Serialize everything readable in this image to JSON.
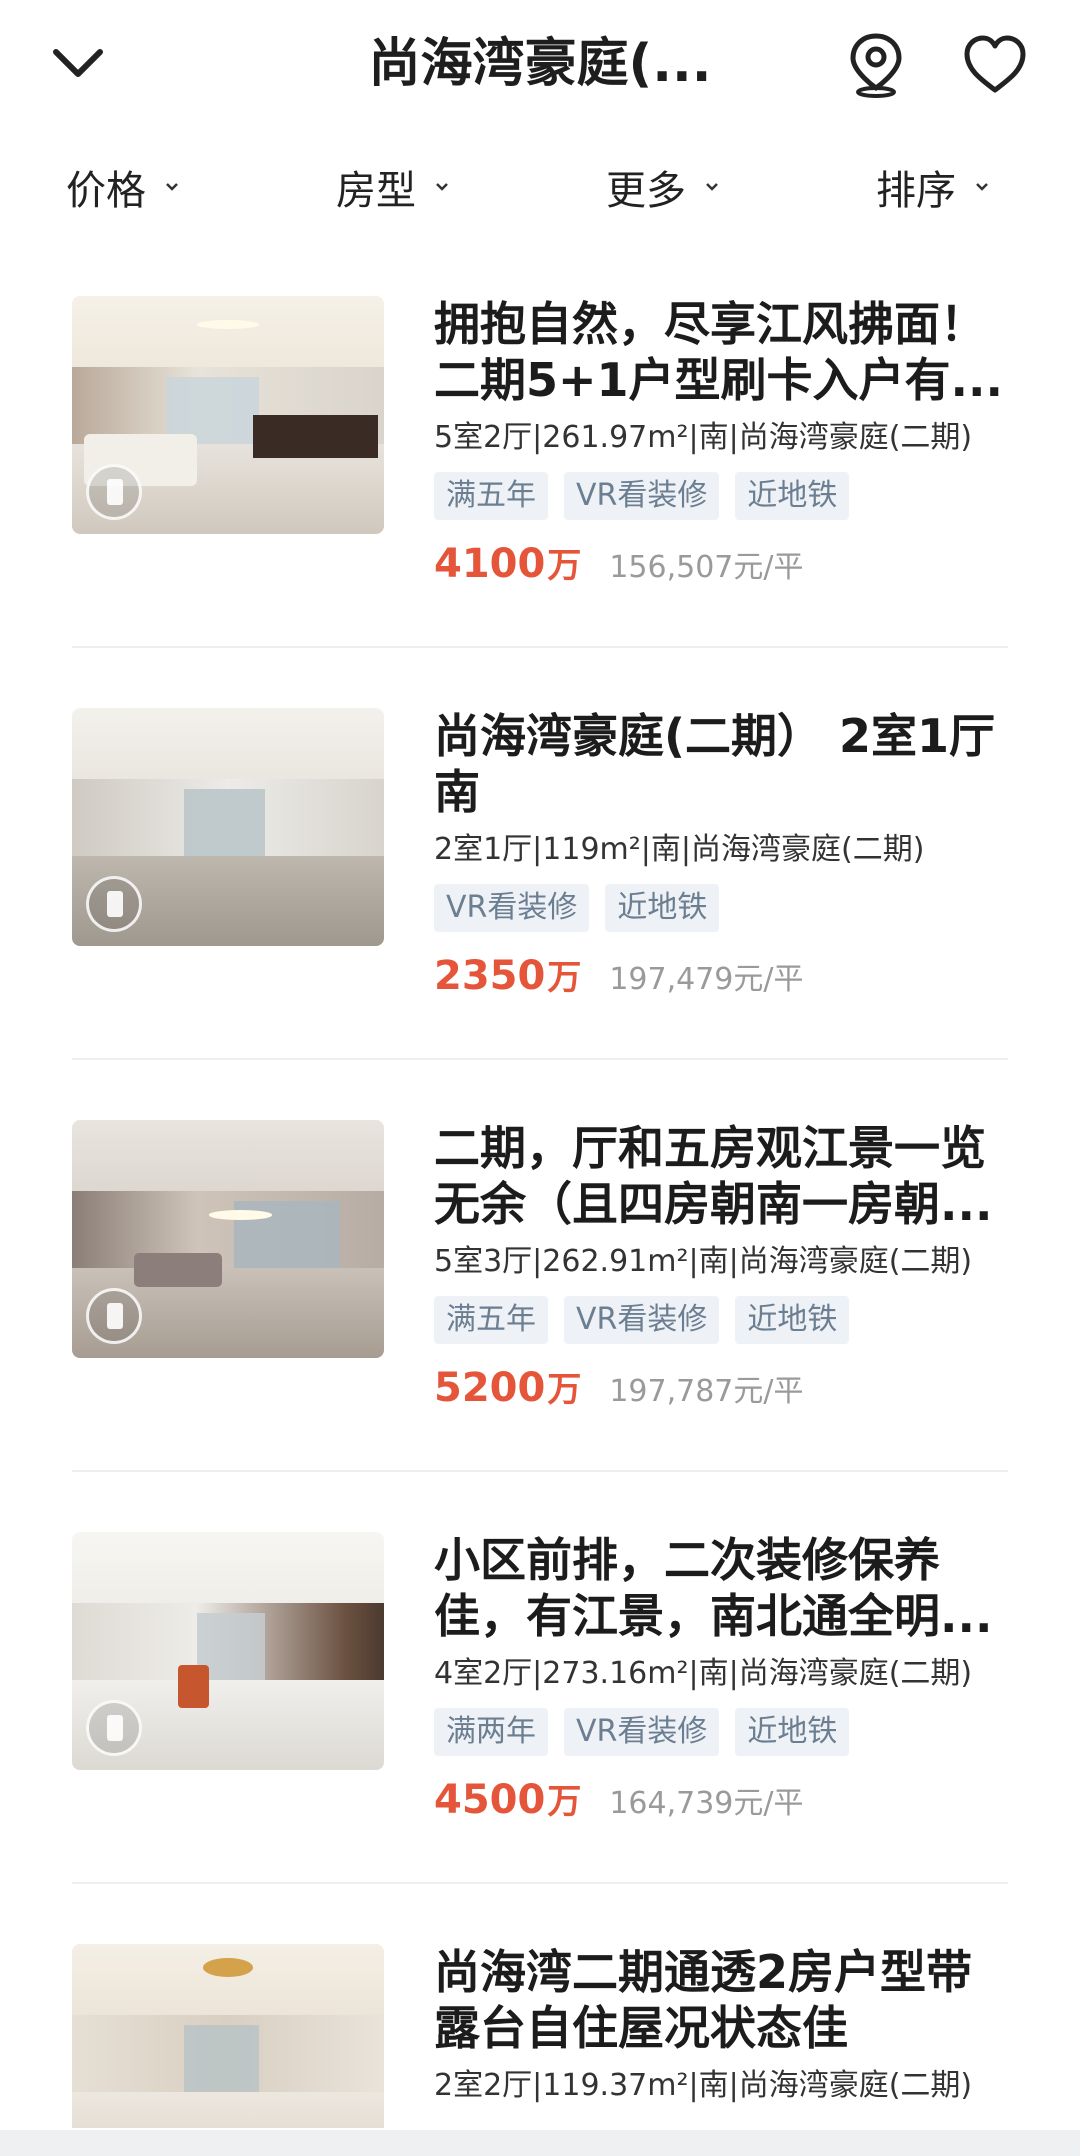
{
  "header": {
    "title": "尚海湾豪庭(...",
    "back_icon": "chevron-down-icon",
    "location_icon": "map-pin-icon",
    "favorite_icon": "heart-icon"
  },
  "filters": [
    {
      "label": "价格"
    },
    {
      "label": "房型"
    },
    {
      "label": "更多"
    },
    {
      "label": "排序"
    }
  ],
  "listings": [
    {
      "title_line1": "拥抱自然，尽享江风拂面！",
      "title_line2": "二期5+1户型刷卡入户有...",
      "meta": "5室2厅|261.97m²|南|尚海湾豪庭(二期)",
      "tags": [
        "满五年",
        "VR看装修",
        "近地铁"
      ],
      "price": "4100",
      "price_unit": "万",
      "unit_price": "156,507元/平"
    },
    {
      "title_line1": "尚海湾豪庭(二期） 2室1厅",
      "title_line2": "南",
      "meta": "2室1厅|119m²|南|尚海湾豪庭(二期)",
      "tags": [
        "VR看装修",
        "近地铁"
      ],
      "price": "2350",
      "price_unit": "万",
      "unit_price": "197,479元/平"
    },
    {
      "title_line1": "二期，厅和五房观江景一览",
      "title_line2": "无余（且四房朝南一房朝...",
      "meta": "5室3厅|262.91m²|南|尚海湾豪庭(二期)",
      "tags": [
        "满五年",
        "VR看装修",
        "近地铁"
      ],
      "price": "5200",
      "price_unit": "万",
      "unit_price": "197,787元/平"
    },
    {
      "title_line1": "小区前排，二次装修保养",
      "title_line2": "佳，有江景，南北通全明...",
      "meta": "4室2厅|273.16m²|南|尚海湾豪庭(二期)",
      "tags": [
        "满两年",
        "VR看装修",
        "近地铁"
      ],
      "price": "4500",
      "price_unit": "万",
      "unit_price": "164,739元/平"
    },
    {
      "title_line1": "尚海湾二期通透2房户型带",
      "title_line2": "露台自住屋况状态佳",
      "meta": "2室2厅|119.37m²|南|尚海湾豪庭(二期)",
      "tags": [],
      "price": "",
      "price_unit": "",
      "unit_price": ""
    }
  ],
  "colors": {
    "price": "#e4553a",
    "tag_bg": "#eef2f6",
    "tag_text": "#6c7f92"
  }
}
